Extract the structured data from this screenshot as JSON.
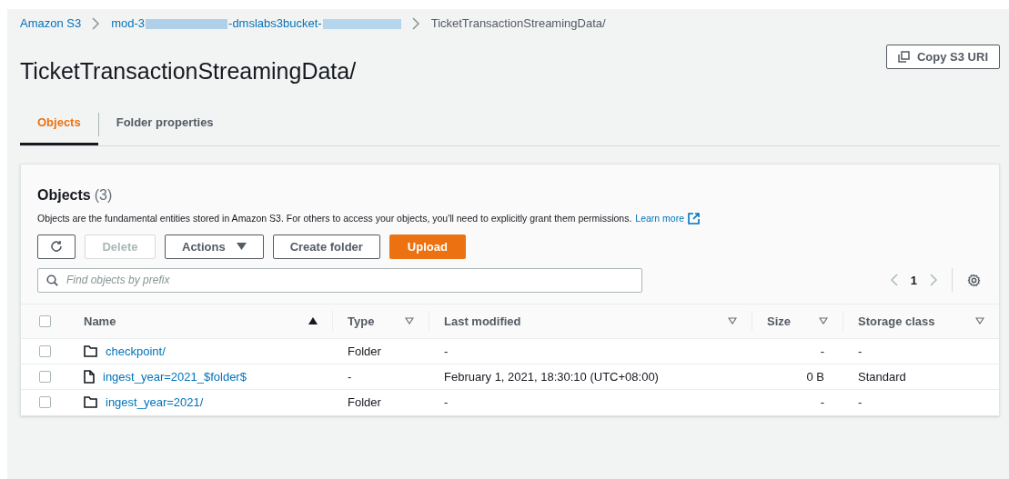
{
  "breadcrumb": {
    "items": [
      {
        "kind": "link",
        "label": "Amazon S3"
      },
      {
        "kind": "redacted",
        "parts": [
          "mod-3",
          "-dmslabs3bucket-"
        ]
      },
      {
        "kind": "current",
        "label": "TicketTransactionStreamingData/"
      }
    ]
  },
  "title": "TicketTransactionStreamingData/",
  "copy_button": "Copy S3 URI",
  "tabs": [
    {
      "label": "Objects",
      "selected": true
    },
    {
      "label": "Folder properties",
      "selected": false
    }
  ],
  "objects": {
    "heading": "Objects",
    "count": "(3)",
    "description": "Objects are the fundamental entities stored in Amazon S3. For others to access your objects, you'll need to explicitly grant them permissions.",
    "learn_more": "Learn more",
    "buttons": [
      {
        "kind": "refresh",
        "disabled": false
      },
      {
        "kind": "text",
        "label": "Delete",
        "disabled": true
      },
      {
        "kind": "dropdown",
        "label": "Actions",
        "disabled": false
      },
      {
        "kind": "text",
        "label": "Create folder",
        "disabled": false
      },
      {
        "kind": "primary",
        "label": "Upload",
        "disabled": false
      }
    ],
    "search": {
      "placeholder": "Find objects by prefix"
    },
    "page": "1",
    "select_all_checked": false,
    "columns": [
      {
        "label": "Name",
        "sorted": true
      },
      {
        "label": "Type",
        "sorted": false
      },
      {
        "label": "Last modified",
        "sorted": false
      },
      {
        "label": "Size",
        "sorted": false
      },
      {
        "label": "Storage class",
        "sorted": false
      }
    ],
    "rows": [
      {
        "kind": "folder",
        "checked": false,
        "name": "checkpoint/",
        "type": "Folder",
        "last_modified": "-",
        "size": "-",
        "storage_class": "-"
      },
      {
        "kind": "file",
        "checked": false,
        "name": "ingest_year=2021_$folder$",
        "type": "-",
        "last_modified": "February 1, 2021, 18:30:10 (UTC+08:00)",
        "size": "0 B",
        "storage_class": "Standard"
      },
      {
        "kind": "folder",
        "checked": false,
        "name": "ingest_year=2021/",
        "type": "Folder",
        "last_modified": "-",
        "size": "-",
        "storage_class": "-"
      }
    ]
  }
}
